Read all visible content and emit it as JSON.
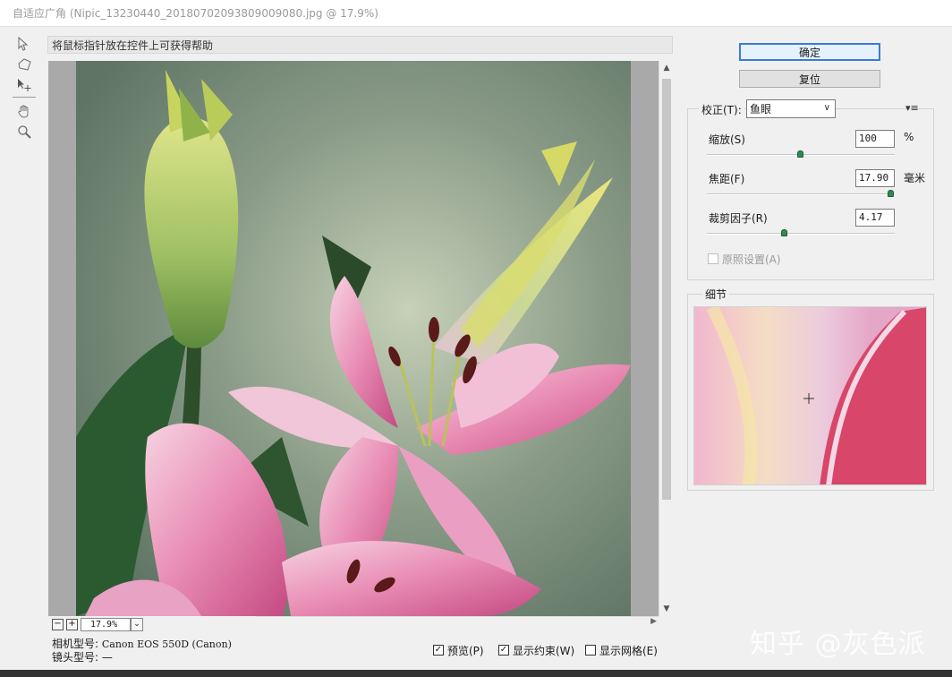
{
  "window": {
    "title": "自适应广角 (Nipic_13230440_20180702093809009080.jpg @ 17.9%)"
  },
  "tools": [
    {
      "name": "constraint-tool-icon"
    },
    {
      "name": "polygon-constraint-tool-icon"
    },
    {
      "name": "move-tool-icon"
    },
    {
      "name": "hand-tool-icon"
    },
    {
      "name": "zoom-tool-icon"
    }
  ],
  "help_text": "将鼠标指针放在控件上可获得帮助",
  "buttons": {
    "ok": "确定",
    "reset": "复位"
  },
  "correction": {
    "label": "校正(T):",
    "selected": "鱼眼",
    "menu_icon": "▾≡"
  },
  "sliders": {
    "scale": {
      "label": "缩放(S)",
      "value": "100",
      "unit": "%",
      "fraction": 0.5
    },
    "focal_length": {
      "label": "焦距(F)",
      "value": "17.90",
      "unit": "毫米",
      "fraction": 1.0
    },
    "crop_factor": {
      "label": "裁剪因子(R)",
      "value": "4.17",
      "unit": "",
      "fraction": 0.41
    }
  },
  "as_shot": {
    "label": "原照设置(A)",
    "checked": false,
    "enabled": false
  },
  "detail": {
    "label": "细节"
  },
  "zoom": {
    "minus": "−",
    "plus": "+",
    "value": "17.9%",
    "dropdown": "⌄"
  },
  "camera": {
    "model_label": "相机型号:",
    "model_value": "Canon EOS 550D (Canon)",
    "lens_label": "镜头型号:",
    "lens_value": "—"
  },
  "options": {
    "preview": {
      "label": "预览(P)",
      "checked": true
    },
    "show_constraints": {
      "label": "显示约束(W)",
      "checked": true
    },
    "show_grid": {
      "label": "显示网格(E)",
      "checked": false
    }
  },
  "watermark": "知乎 @灰色派",
  "colors": {
    "primary_button_border": "#3a7bd5",
    "slider_knob": "#2c8a50",
    "preview_background": "#a9a9a9"
  }
}
